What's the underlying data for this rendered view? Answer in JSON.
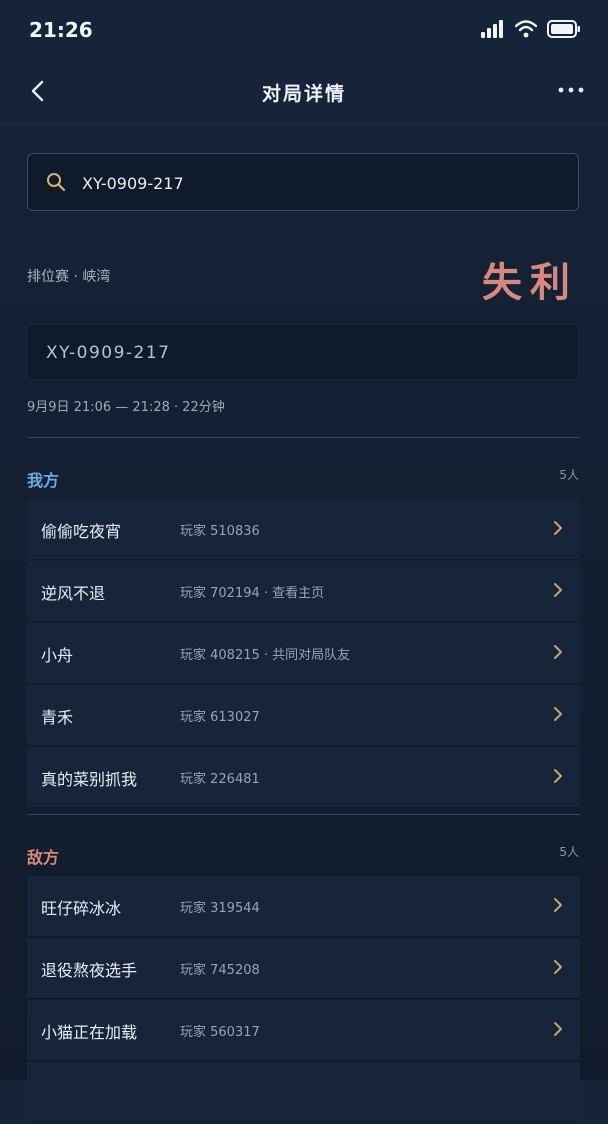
{
  "status": {
    "time": "21:26"
  },
  "nav": {
    "title": "对局详情"
  },
  "search": {
    "value": "XY-0909-217",
    "placeholder": ""
  },
  "match": {
    "mode": "排位赛 · 峡湾",
    "result": "失利",
    "result_color": "#d9897b",
    "id": "XY-0909-217",
    "datetime": "9月9日 21:06 — 21:28 · 22分钟"
  },
  "ally": {
    "title": "我方",
    "title_color": "#6ea8e0",
    "count": "5人",
    "players": [
      {
        "name": "偷偷吃夜宵",
        "info": "玩家 510836"
      },
      {
        "name": "逆风不退",
        "info": "玩家 702194 · 查看主页"
      },
      {
        "name": "小舟",
        "info": "玩家 408215 · 共同对局队友"
      },
      {
        "name": "青禾",
        "info": "玩家 613027"
      },
      {
        "name": "真的菜别抓我",
        "info": "玩家 226481"
      }
    ]
  },
  "enemy": {
    "title": "敌方",
    "title_color": "#d9897b",
    "count": "5人",
    "players": [
      {
        "name": "旺仔碎冰冰",
        "info": "玩家 319544"
      },
      {
        "name": "退役熬夜选手",
        "info": "玩家 745208"
      },
      {
        "name": "小猫正在加载",
        "info": "玩家 560317"
      }
    ]
  },
  "icons": {
    "chevron_color": "#c9a46a"
  }
}
